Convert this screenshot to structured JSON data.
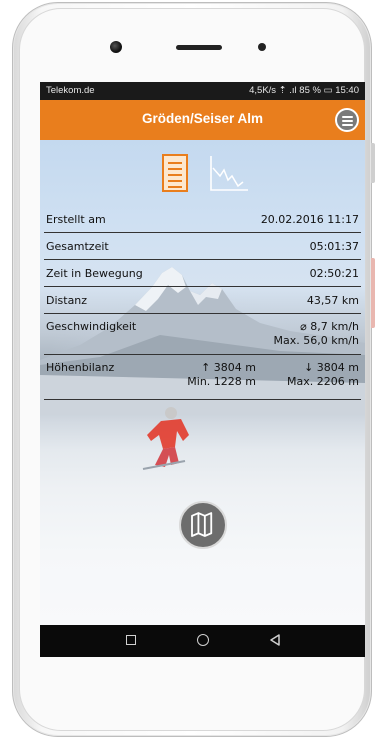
{
  "status_bar": {
    "carrier": "Telekom.de",
    "right_text": "4,5K/s ⇡ .ıl 85 % ▭ 15:40"
  },
  "app_bar": {
    "title": "Gröden/Seiser Alm",
    "menu_icon": "hamburger-menu-icon"
  },
  "view_toggle": {
    "list_icon": "list-icon",
    "chart_icon": "elevation-chart-icon",
    "active": "list"
  },
  "stats": {
    "erstellt": {
      "label": "Erstellt am",
      "value": "20.02.2016 11:17"
    },
    "gesamtzeit": {
      "label": "Gesamtzeit",
      "value": "05:01:37"
    },
    "bewegung": {
      "label": "Zeit in Bewegung",
      "value": "02:50:21"
    },
    "distanz": {
      "label": "Distanz",
      "value": "43,57 km"
    },
    "geschwindigkeit": {
      "label": "Geschwindigkeit",
      "avg": "⌀ 8,7 km/h",
      "max": "Max. 56,0 km/h"
    },
    "hoehenbilanz": {
      "label": "Höhenbilanz",
      "up": "↑ 3804 m",
      "min": "Min. 1228 m",
      "down": "↓ 3804 m",
      "max": "Max. 2206 m"
    }
  },
  "map_button": {
    "icon": "map-icon"
  },
  "nav_bar": {
    "items": [
      "recent-apps-icon",
      "home-icon",
      "back-icon"
    ]
  },
  "colors": {
    "accent": "#e97e1d",
    "status_bar": "#1a1a1a",
    "nav_bar": "#0a0a0a"
  }
}
